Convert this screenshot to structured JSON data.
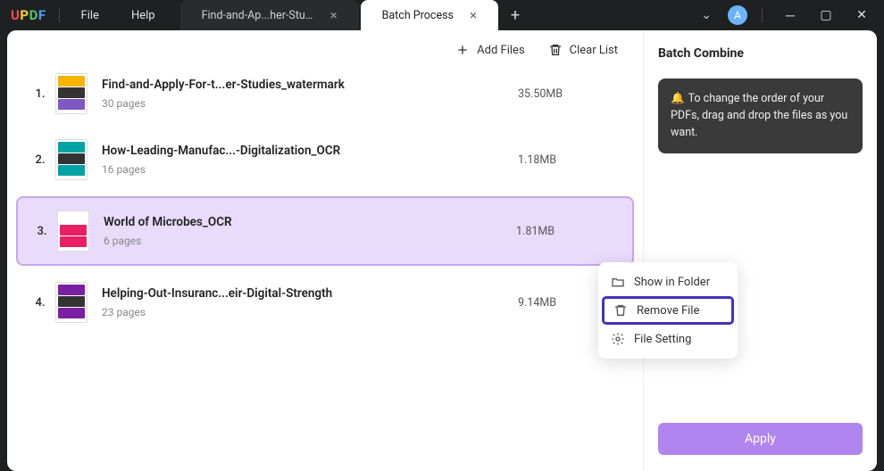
{
  "app": {
    "logo": "UPDF"
  },
  "menus": {
    "file": "File",
    "help": "Help"
  },
  "tabs": [
    {
      "label": "Find-and-Ap...her-Studies",
      "active": false
    },
    {
      "label": "Batch Process",
      "active": true
    }
  ],
  "user": {
    "initial": "A"
  },
  "actions": {
    "add_files": "Add Files",
    "clear_list": "Clear List"
  },
  "files": [
    {
      "num": "1.",
      "name": "Find-and-Apply-For-t...er-Studies_watermark",
      "pages": "30 pages",
      "size": "35.50MB",
      "colors": [
        "#f4b400",
        "#333",
        "#7e57c2"
      ]
    },
    {
      "num": "2.",
      "name": "How-Leading-Manufac...-Digitalization_OCR",
      "pages": "16 pages",
      "size": "1.18MB",
      "colors": [
        "#00a3a3",
        "#333",
        "#00a3a3"
      ]
    },
    {
      "num": "3.",
      "name": "World of Microbes_OCR",
      "pages": "6 pages",
      "size": "1.81MB",
      "colors": [
        "#fff",
        "#e91e63",
        "#e91e63"
      ],
      "selected": true
    },
    {
      "num": "4.",
      "name": "Helping-Out-Insuranc...eir-Digital-Strength",
      "pages": "23 pages",
      "size": "9.14MB",
      "colors": [
        "#7b1fa2",
        "#333",
        "#7b1fa2"
      ]
    }
  ],
  "context_menu": {
    "show_in_folder": "Show in Folder",
    "remove_file": "Remove File",
    "file_setting": "File Setting"
  },
  "panel": {
    "title": "Batch Combine",
    "notice": "To change the order of your PDFs, drag and drop the files as you want.",
    "apply": "Apply"
  }
}
